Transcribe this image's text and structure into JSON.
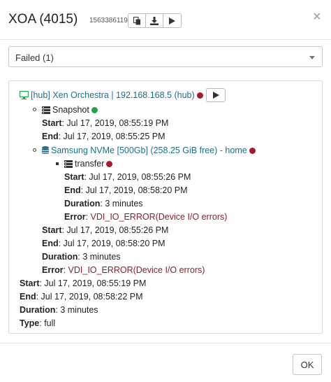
{
  "header": {
    "title": "XOA (4015)",
    "job_id": "1563386119628",
    "copy_icon": "copy-icon",
    "download_icon": "download-icon",
    "play_icon": "play-icon",
    "close_label": "×"
  },
  "filter": {
    "selected": "Failed (1)"
  },
  "log": {
    "vm_label": "[hub] Xen Orchestra | 192.168.168.5 (hub)",
    "snapshot": {
      "label": "Snapshot",
      "start_label": "Start",
      "start_value": ": Jul 17, 2019, 08:55:19 PM",
      "end_label": "End",
      "end_value": ": Jul 17, 2019, 08:55:25 PM"
    },
    "sr": {
      "label": "Samsung NVMe [500Gb] (258.25 GiB free) - home",
      "transfer": {
        "label": "transfer",
        "start_label": "Start",
        "start_value": ": Jul 17, 2019, 08:55:26 PM",
        "end_label": "End",
        "end_value": ": Jul 17, 2019, 08:58:20 PM",
        "duration_label": "Duration",
        "duration_value": ": 3 minutes",
        "error_label": "Error",
        "error_sep": ": ",
        "error_value": "VDI_IO_ERROR(Device I/O errors)"
      },
      "start_label": "Start",
      "start_value": ": Jul 17, 2019, 08:55:26 PM",
      "end_label": "End",
      "end_value": ": Jul 17, 2019, 08:58:20 PM",
      "duration_label": "Duration",
      "duration_value": ": 3 minutes",
      "error_label": "Error",
      "error_sep": ": ",
      "error_value": "VDI_IO_ERROR(Device I/O errors)"
    },
    "summary": {
      "start_label": "Start",
      "start_value": ": Jul 17, 2019, 08:55:19 PM",
      "end_label": "End",
      "end_value": ": Jul 17, 2019, 08:58:22 PM",
      "duration_label": "Duration",
      "duration_value": ": 3 minutes",
      "type_label": "Type",
      "type_value": ": full"
    }
  },
  "footer": {
    "ok_label": "OK"
  },
  "colors": {
    "failed": "#a11d2a",
    "success": "#21a34a",
    "link": "#1f6f8b",
    "error_text": "#8a1f2c"
  }
}
